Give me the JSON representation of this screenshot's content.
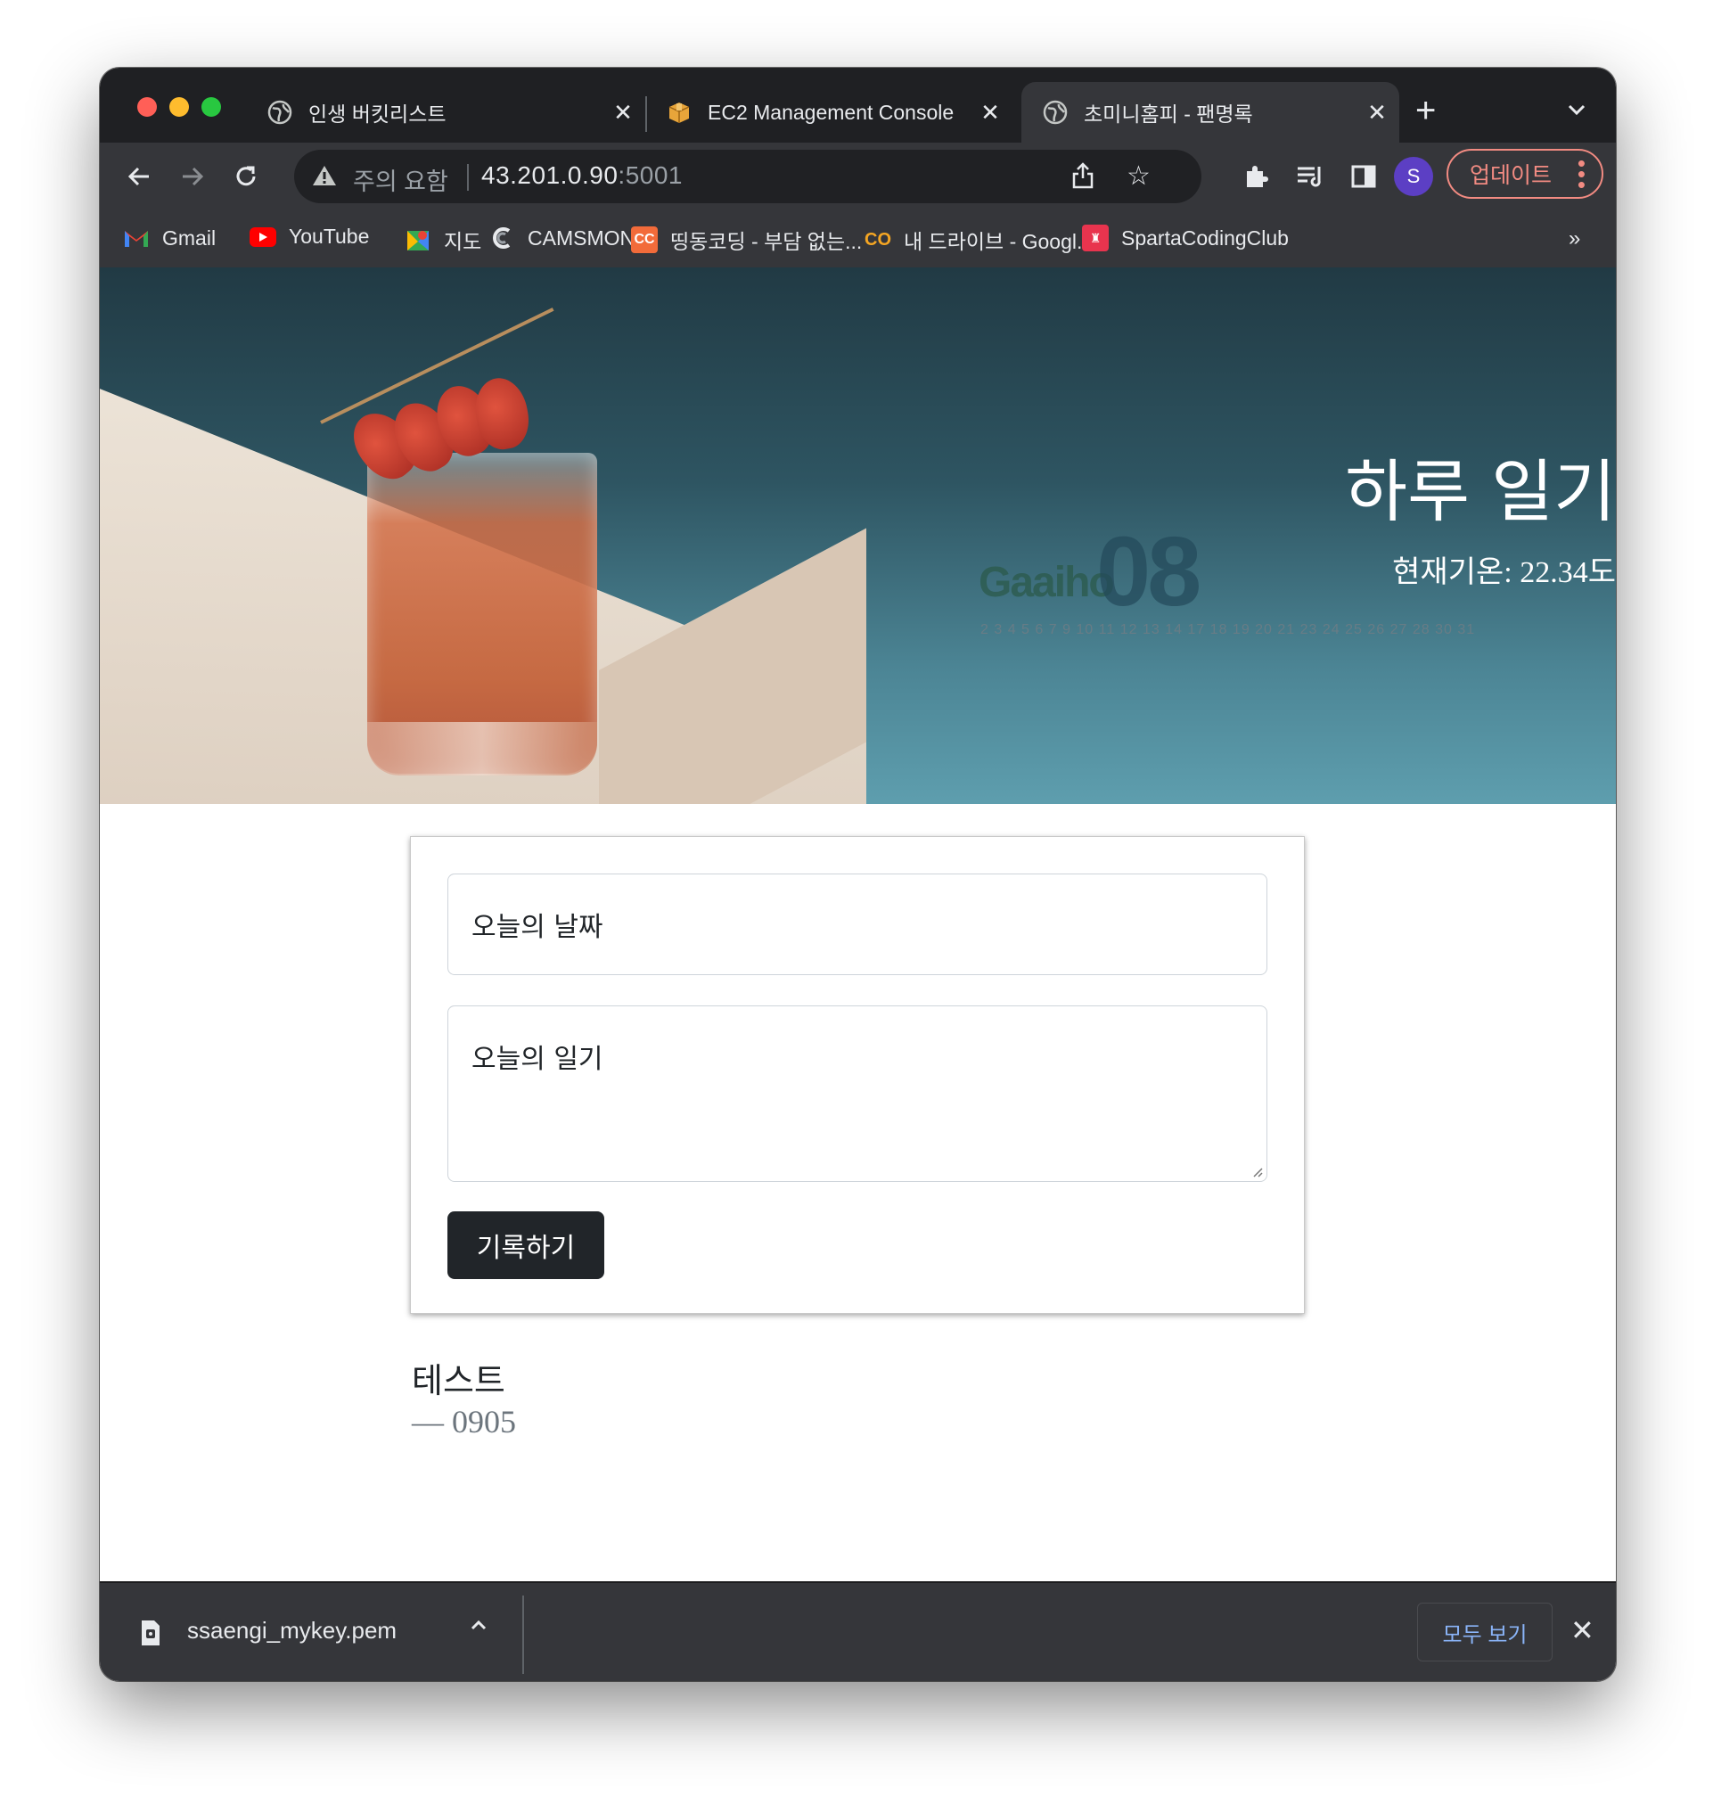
{
  "tabs": [
    {
      "title": "인생 버킷리스트",
      "active": false
    },
    {
      "title": "EC2 Management Console",
      "active": false
    },
    {
      "title": "초미니홈피 - 팬명록",
      "active": true
    }
  ],
  "omnibox": {
    "warning": "주의 요함",
    "host": "43.201.0.90",
    "port": ":5001"
  },
  "profile_initial": "S",
  "update_label": "업데이트",
  "bookmarks": [
    {
      "label": "Gmail",
      "icon": "gmail-icon"
    },
    {
      "label": "YouTube",
      "icon": "youtube-icon"
    },
    {
      "label": "지도",
      "icon": "maps-icon"
    },
    {
      "label": "CAMSMON",
      "icon": "camsmon-icon"
    },
    {
      "label": "띵동코딩 - 부담 없는...",
      "icon": "ddingdong-icon"
    },
    {
      "label": "내 드라이브 - Googl...",
      "icon": "drive-icon"
    },
    {
      "label": "SpartaCodingClub",
      "icon": "sparta-icon"
    }
  ],
  "bookmarks_more": "»",
  "hero": {
    "title": "하루 일기",
    "temperature": "현재기온: 22.34도",
    "calendar_brand": "Gaaiho",
    "calendar_month": "08",
    "calendar_days": "2 3 4 5 6 7  9 10 11 12 13 14   17 18 19 20 21   23 24 25 26 27 28   30 31"
  },
  "form": {
    "date_placeholder": "오늘의 날짜",
    "diary_placeholder": "오늘의 일기",
    "submit_label": "기록하기"
  },
  "entries": [
    {
      "title": "테스트",
      "date": "— 0905"
    }
  ],
  "download": {
    "filename": "ssaengi_mykey.pem",
    "show_all": "모두 보기"
  },
  "colors": {
    "accent_update": "#f28b82",
    "link_blue": "#8ab4f8",
    "button_dark": "#212529"
  }
}
